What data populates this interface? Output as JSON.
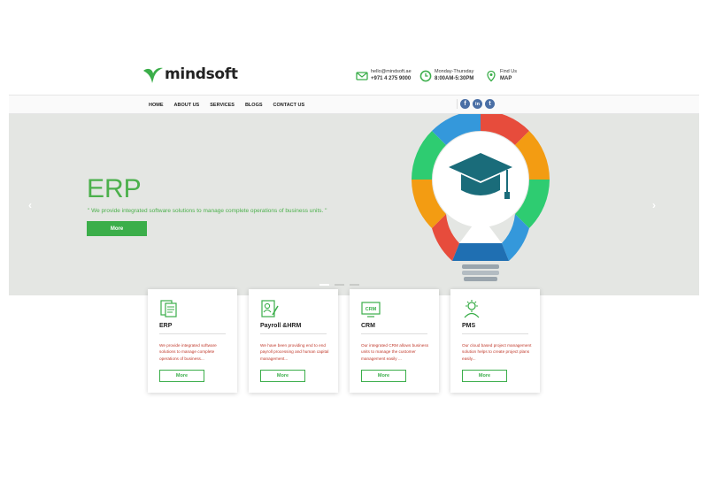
{
  "header": {
    "logo_text": "mindsoft",
    "email": "hello@mindsoft.ae",
    "phone": "+971 4 275 9000",
    "hours_label": "Monday-Thursday",
    "hours": "8:00AM-5:30PM",
    "find_label": "Find Us",
    "map_label": "MAP"
  },
  "nav": {
    "items": [
      "HOME",
      "ABOUT US",
      "SERVICES",
      "BLOGS",
      "CONTACT US"
    ],
    "social": [
      "f",
      "in",
      "t"
    ]
  },
  "hero": {
    "title": "ERP",
    "quote": "\" We provide integrated software solutions to manage complete operations of business units. \"",
    "button": "More",
    "prev_arrow": "‹",
    "next_arrow": "›",
    "slides_total": 3,
    "slide_active": 1
  },
  "cards": [
    {
      "title": "ERP",
      "desc": "We provide integrated software solutions to manage complete operations of business...",
      "button": "More",
      "icon": "erp-icon"
    },
    {
      "title": "Payroll &HRM",
      "desc": "We have been providing end to end payroll processing and human capital management...",
      "button": "More",
      "icon": "payroll-icon"
    },
    {
      "title": "CRM",
      "desc": "Our integrated CRM allows business units to manage the customer management easily ...",
      "button": "More",
      "icon": "crm-icon",
      "icon_text": "CRM"
    },
    {
      "title": "PMS",
      "desc": "Our cloud based project management solution helps to create project plans easily...",
      "button": "More",
      "icon": "pms-icon"
    }
  ],
  "colors": {
    "brand_green": "#3bae4a",
    "hero_bg": "#e4e6e3",
    "desc_red": "#c0392b",
    "social_blue": "#4a6fa5"
  }
}
